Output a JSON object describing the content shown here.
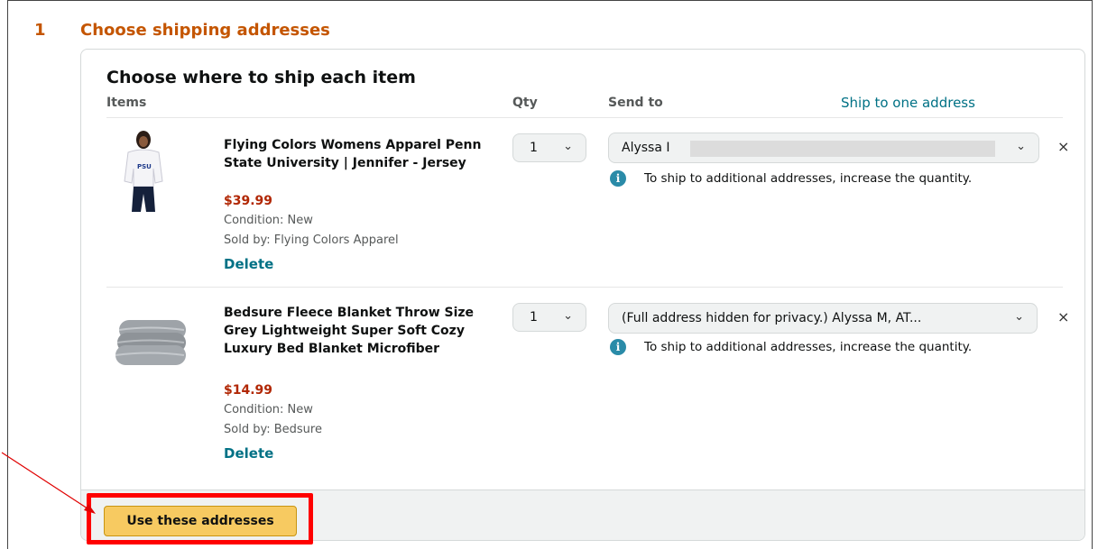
{
  "step": {
    "number": "1",
    "title": "Choose shipping addresses"
  },
  "card": {
    "heading": "Choose where to ship each item",
    "columns": {
      "items": "Items",
      "qty": "Qty",
      "send_to": "Send to"
    },
    "ship_one_link": "Ship to one address"
  },
  "items": [
    {
      "title": "Flying Colors Womens Apparel Penn State University | Jennifer - Jersey",
      "price": "$39.99",
      "condition": "Condition: New",
      "seller": "Sold by: Flying Colors Apparel",
      "delete_label": "Delete",
      "qty": "1",
      "address": "Alyssa I",
      "close": "×",
      "info": "To ship to additional addresses, increase the quantity.",
      "image_icon": "jersey-product-image"
    },
    {
      "title": "Bedsure Fleece Blanket Throw Size Grey Lightweight Super Soft Cozy Luxury Bed Blanket Microfiber",
      "price": "$14.99",
      "condition": "Condition: New",
      "seller": "Sold by: Bedsure",
      "delete_label": "Delete",
      "qty": "1",
      "address": "(Full address hidden for privacy.) Alyssa M, AT...",
      "close": "×",
      "info": "To ship to additional addresses, increase the quantity.",
      "image_icon": "blanket-product-image"
    }
  ],
  "icons": {
    "chevron": "⌄",
    "info": "i"
  },
  "footer": {
    "button_label": "Use these addresses"
  },
  "colors": {
    "accent": "#c45500",
    "link": "#007185",
    "price": "#b12704",
    "button": "#f7ca61",
    "highlight": "#ff0000"
  }
}
